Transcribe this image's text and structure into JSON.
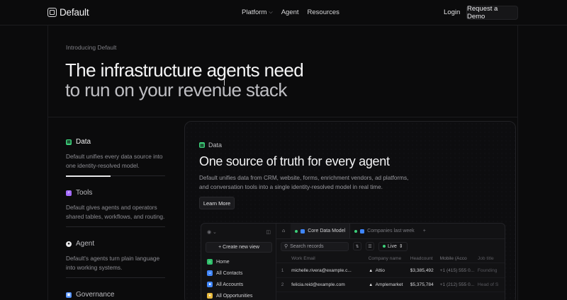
{
  "nav": {
    "logo": "Default",
    "links": [
      "Platform",
      "Agent",
      "Resources"
    ],
    "login": "Login",
    "cta": "Request a Demo"
  },
  "hero": {
    "eyebrow": "Introducing Default",
    "line1": "The infrastructure agents need",
    "line2": "to run on your revenue stack"
  },
  "features": [
    {
      "title": "Data",
      "desc": "Default unifies every data source into one identity-resolved model.",
      "icon_color": "#3ccf7a",
      "progress": 0.45
    },
    {
      "title": "Tools",
      "desc": "Default gives agents and operators shared tables, workflows, and routing.",
      "icon_color": "#a46bff"
    },
    {
      "title": "Agent",
      "desc": "Default's agents turn plain language into working systems.",
      "icon_color": "#e8e8ea"
    },
    {
      "title": "Governance",
      "icon_color": "#4c8dff"
    }
  ],
  "card": {
    "tag": "Data",
    "title": "One source of truth for every agent",
    "desc": "Default unifies data from CRM, website, forms, enrichment vendors, ad platforms, and conversation tools into a single identity-resolved model in real time.",
    "button": "Learn More"
  },
  "app": {
    "new_view": "+ Create new view",
    "sidebar": [
      {
        "label": "Home",
        "color": "#2fbf6a"
      },
      {
        "label": "All Contacts",
        "color": "#3f86ff"
      },
      {
        "label": "All Accounts",
        "color": "#3f86ff"
      },
      {
        "label": "All Opportunities",
        "color": "#e7b93c"
      }
    ],
    "tabs": [
      {
        "label": "Core Data Model"
      },
      {
        "label": "Companies last week"
      }
    ],
    "search_placeholder": "Search records",
    "live": "Live",
    "columns": [
      "Work Email",
      "Company name",
      "Headcount",
      "Mobile (Acco",
      "Job title"
    ],
    "rows": [
      {
        "num": "1",
        "email": "michelle.rivera@example.c...",
        "company": "Attio",
        "headcount": "$3,385,492",
        "phone": "+1 (415) 555 0...",
        "title": "Founding"
      },
      {
        "num": "2",
        "email": "felicia.reid@example.com",
        "company": "Amplemarket",
        "headcount": "$5,375,784",
        "phone": "+1 (212) 555 0...",
        "title": "Head of S"
      }
    ]
  }
}
